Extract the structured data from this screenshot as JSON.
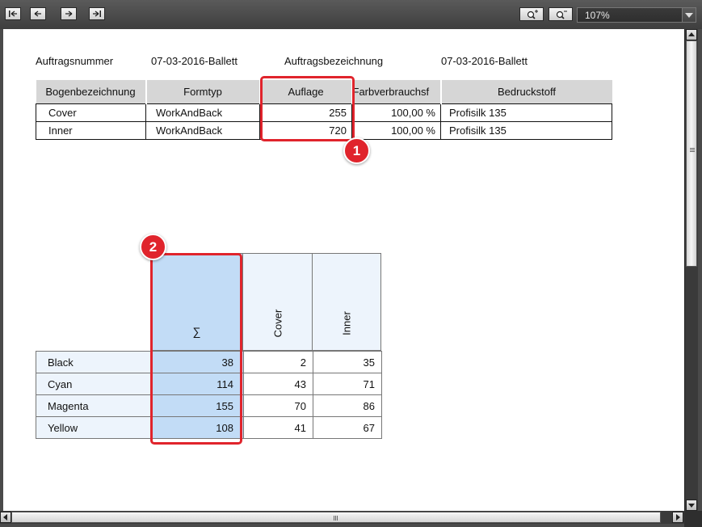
{
  "toolbar": {
    "nav_buttons": [
      "first-page-icon",
      "previous-page-icon",
      "next-page-icon",
      "last-page-icon"
    ],
    "zoom_in_icon": "zoom-in-icon",
    "zoom_out_icon": "zoom-out-icon",
    "zoom_level": "107%"
  },
  "header": {
    "order_number_label": "Auftragsnummer",
    "order_number_value": "07-03-2016-Ballett",
    "order_name_label": "Auftragsbezeichnung",
    "order_name_value": "07-03-2016-Ballett"
  },
  "sheet_table": {
    "columns": [
      "Bogenbezeichnung",
      "Formtyp",
      "Auflage",
      "Farbverbrauchsf",
      "Bedruckstoff"
    ],
    "rows": [
      [
        "Cover",
        "WorkAndBack",
        "255",
        "100,00 %",
        "Profisilk 135"
      ],
      [
        "Inner",
        "WorkAndBack",
        "720",
        "100,00 %",
        "Profisilk 135"
      ]
    ]
  },
  "ink_table": {
    "sum_header": "∑",
    "sheet_headers": [
      "Cover",
      "Inner"
    ],
    "rows": [
      {
        "label": "Black",
        "sum": "38",
        "cover": "2",
        "inner": "35"
      },
      {
        "label": "Cyan",
        "sum": "114",
        "cover": "43",
        "inner": "71"
      },
      {
        "label": "Magenta",
        "sum": "155",
        "cover": "70",
        "inner": "86"
      },
      {
        "label": "Yellow",
        "sum": "108",
        "cover": "41",
        "inner": "67"
      }
    ]
  },
  "callouts": [
    "1",
    "2"
  ],
  "colors": {
    "highlight": "#e0242c",
    "sum_column": "#c2dcf6",
    "header_gray": "#d6d6d6",
    "label_bg": "#edf4fc"
  }
}
